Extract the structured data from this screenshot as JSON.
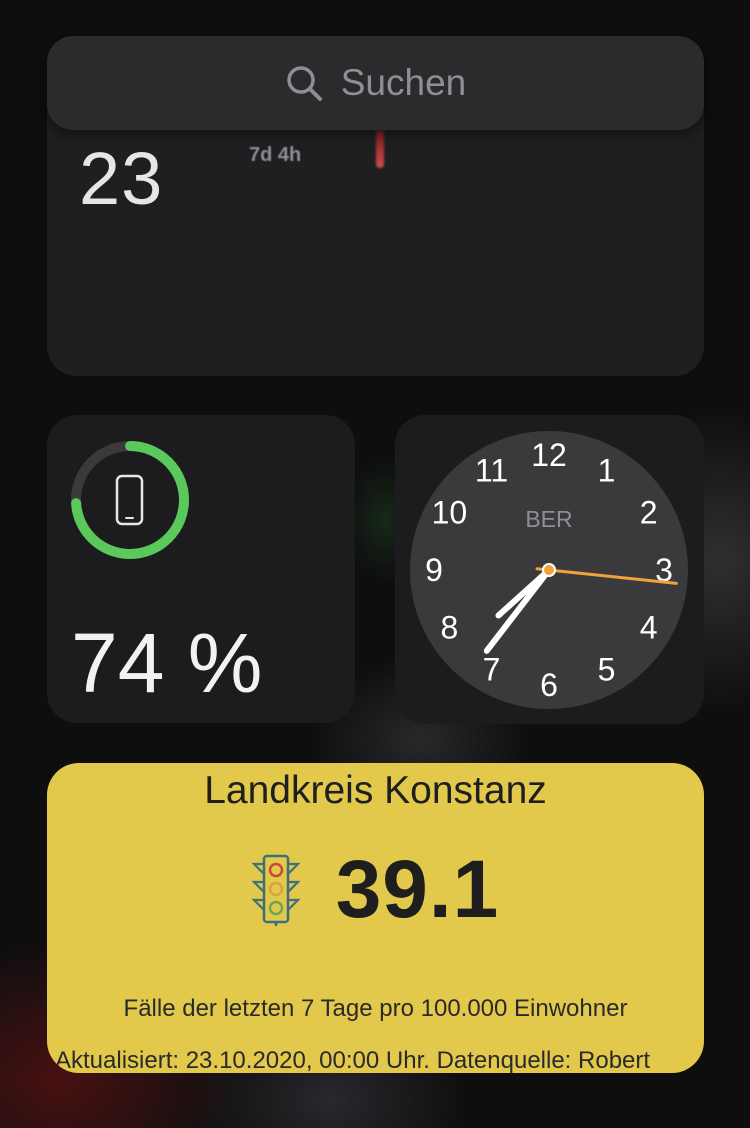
{
  "search": {
    "placeholder": "Suchen"
  },
  "top_widget": {
    "big_value": "23",
    "small_label": "7d 4h"
  },
  "battery_widget": {
    "percent_text": "74 %",
    "level": 0.74,
    "ring_color": "#5ac85a",
    "icon": "iphone-icon"
  },
  "clock_widget": {
    "city": "BER",
    "numbers": [
      "12",
      "1",
      "2",
      "3",
      "4",
      "5",
      "6",
      "7",
      "8",
      "9",
      "10",
      "11"
    ],
    "time": {
      "hour": 7,
      "minute": 36,
      "second": 16
    },
    "second_hand_color": "#f2a23a"
  },
  "covid_widget": {
    "county": "Landkreis Konstanz",
    "value": "39.1",
    "icon": "traffic-light-icon",
    "description": "Fälle der letzten 7 Tage pro 100.000 Einwohner",
    "updated": "Aktualisiert: 23.10.2020, 00:00 Uhr. Datenquelle: Robert",
    "background_color": "#e2c84b"
  }
}
